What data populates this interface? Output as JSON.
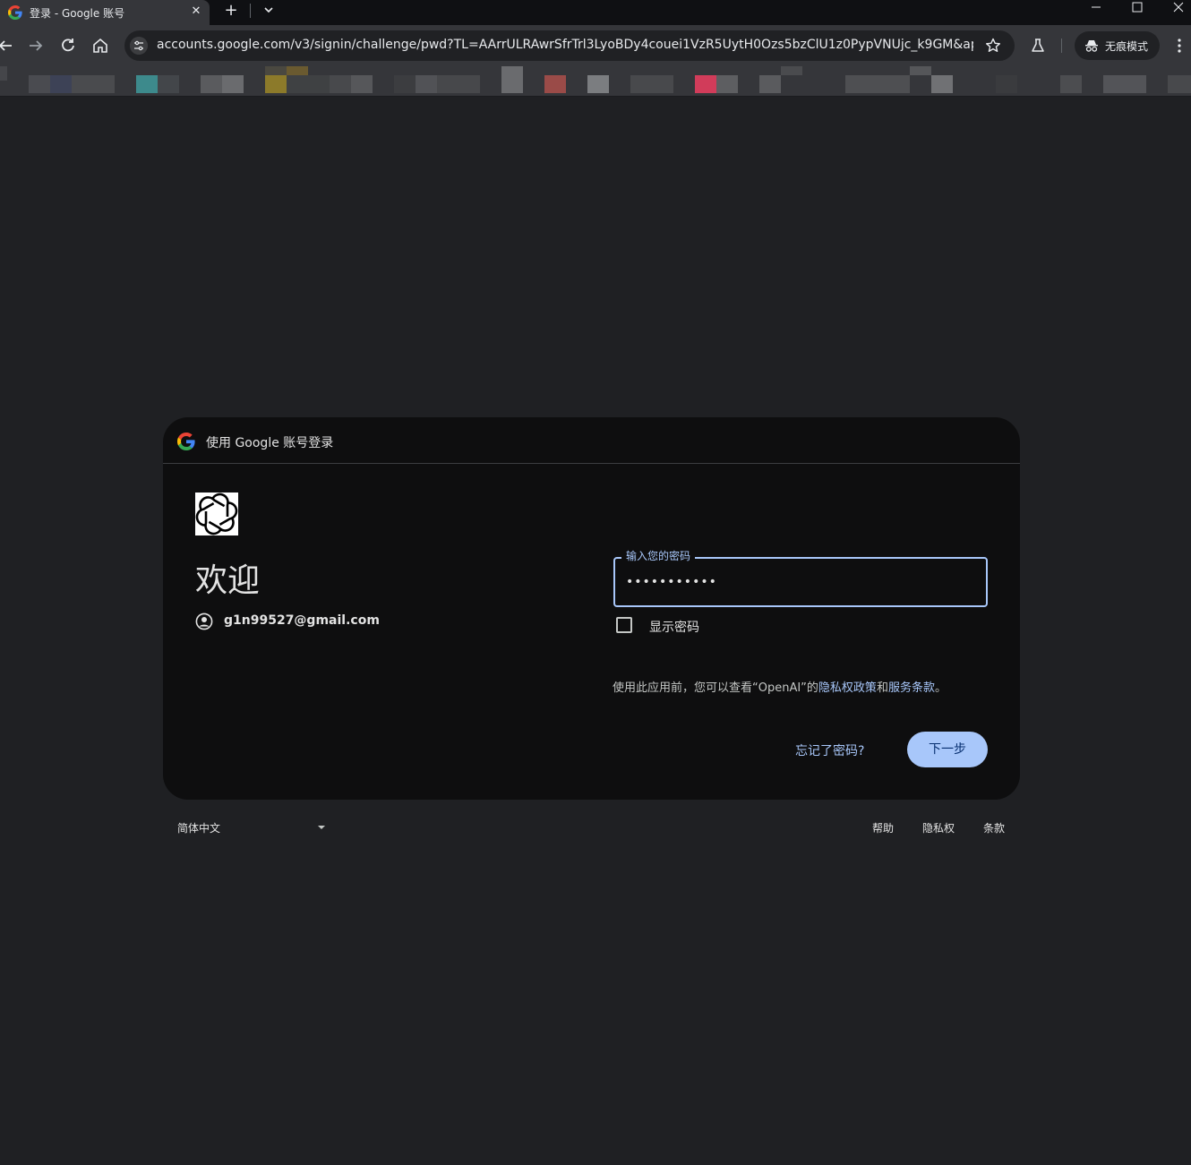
{
  "browser": {
    "tab_title": "登录 - Google 账号",
    "url": "accounts.google.com/v3/signin/challenge/pwd?TL=AArrULRAwrSfrTrl3LyoBDy4couei1VzR5UytH0Ozs5bzClU1z0PypVNUjc_k9GM&app...",
    "incognito_label": "无痕模式"
  },
  "card": {
    "header_text": "使用 Google 账号登录",
    "welcome_title": "欢迎",
    "account_email": "g1n99527@gmail.com",
    "password_label": "输入您的密码",
    "password_value": "•••••••••••",
    "show_password_label": "显示密码",
    "show_password_checked": false,
    "policy": {
      "prefix": "使用此应用前，您可以查看“OpenAI”的",
      "privacy_link": "隐私权政策",
      "and": "和",
      "terms_link": "服务条款",
      "suffix": "。"
    },
    "forgot_password": "忘记了密码?",
    "next_button": "下一步"
  },
  "footer": {
    "language": "简体中文",
    "help": "帮助",
    "privacy": "隐私权",
    "terms": "条款"
  },
  "colors": {
    "accent": "#a8c7fa",
    "page_bg": "#1f2023",
    "card_bg": "#0e0e0f"
  }
}
